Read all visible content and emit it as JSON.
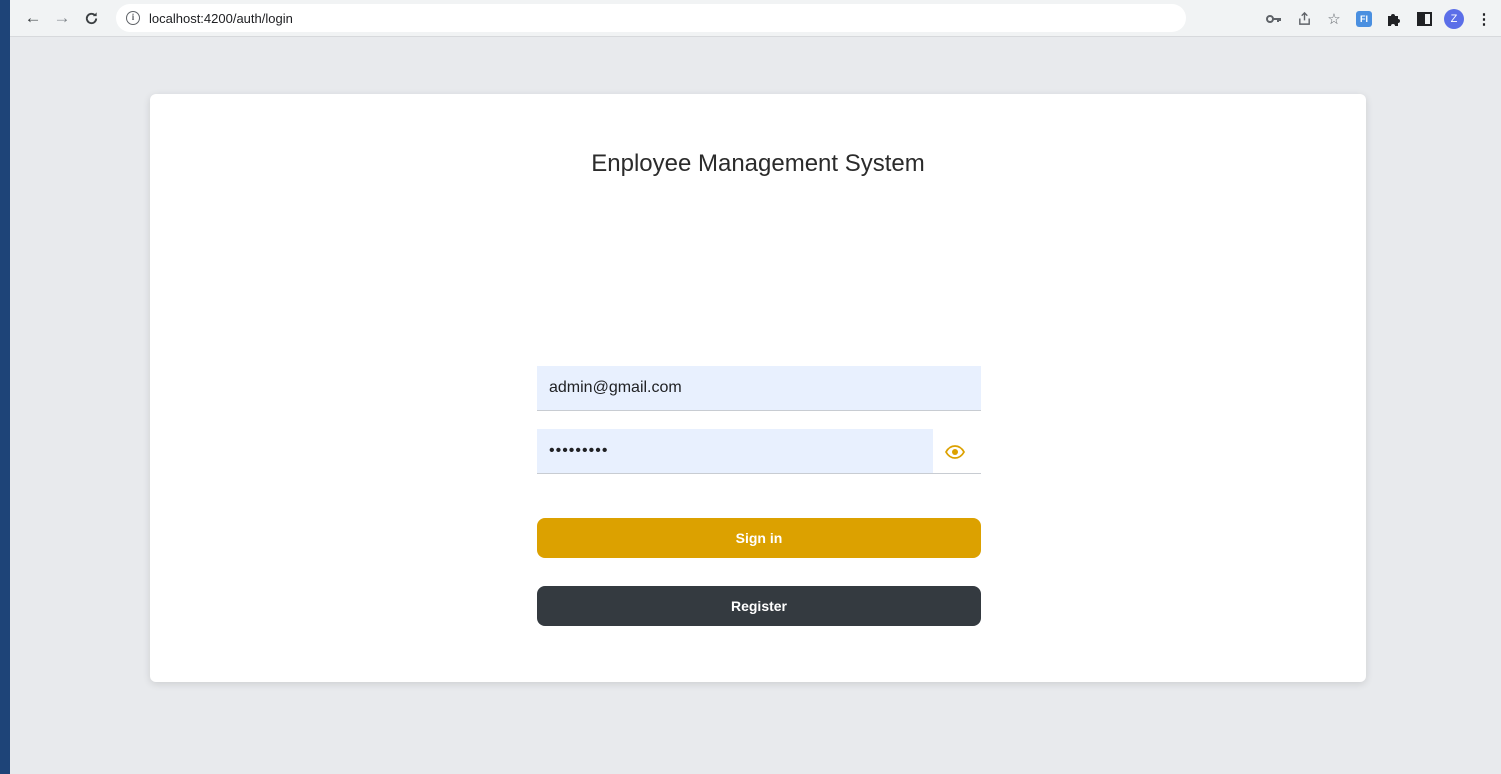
{
  "browser": {
    "url": "localhost:4200/auth/login",
    "avatar_letter": "Z",
    "extension_label": "FI"
  },
  "login": {
    "title": "Enployee Management System",
    "email_value": "admin@gmail.com",
    "password_value": "•••••••••",
    "signin_label": "Sign in",
    "register_label": "Register"
  },
  "colors": {
    "accent": "#dca100",
    "secondary": "#343a40",
    "input_bg": "#e8f0fe"
  },
  "icons": {
    "back": "arrow-left-icon",
    "forward": "arrow-right-icon",
    "reload": "reload-icon",
    "site_info": "info-icon",
    "password_manager": "key-icon",
    "share": "share-icon",
    "bookmark": "star-icon",
    "extensions": "puzzle-icon",
    "side_panel": "side-panel-icon",
    "menu": "kebab-menu-icon",
    "toggle_password": "eye-icon"
  }
}
